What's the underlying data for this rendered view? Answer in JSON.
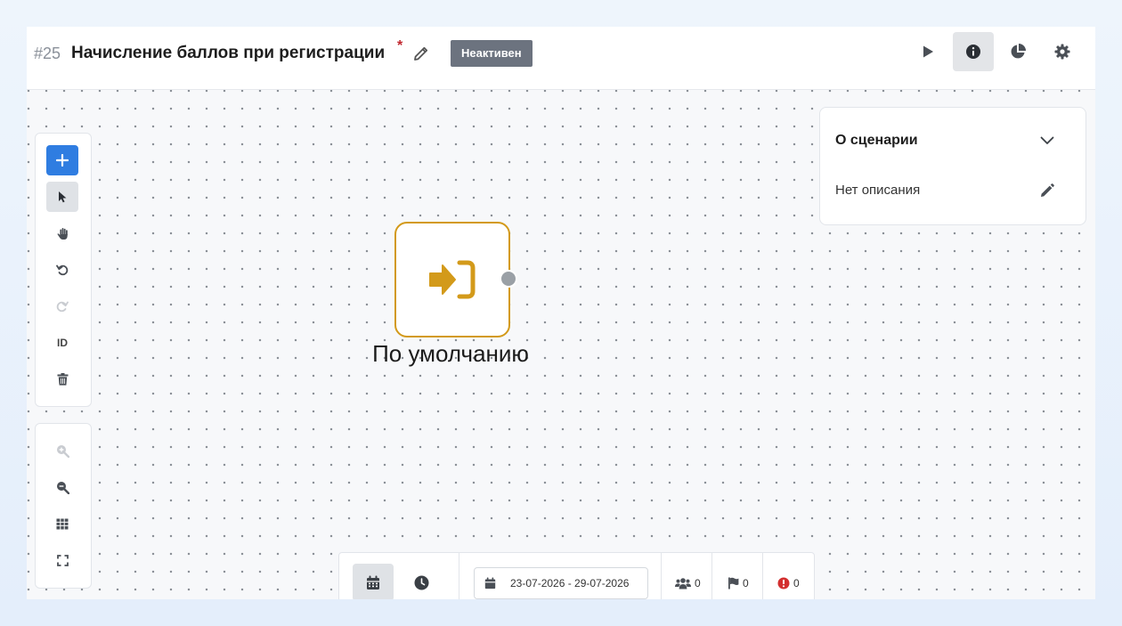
{
  "header": {
    "scenario_id": "#25",
    "title": "Начисление баллов при регистрации",
    "required_mark": "*",
    "status": "Неактивен",
    "actions": [
      {
        "name": "play-icon"
      },
      {
        "name": "info-icon",
        "active": true
      },
      {
        "name": "pie-chart-icon"
      },
      {
        "name": "gear-icon"
      }
    ]
  },
  "toolbar": {
    "add": "plus-icon",
    "select": "cursor-icon",
    "pan": "hand-icon",
    "undo": "undo-icon",
    "redo": "redo-icon",
    "id_label": "ID",
    "delete": "trash-icon"
  },
  "zoom_toolbar": {
    "zoom_in": "zoom-in-icon",
    "zoom_out": "zoom-out-icon",
    "grid": "grid-icon",
    "fit": "fullscreen-icon"
  },
  "node": {
    "label": "По умолчанию",
    "icon": "sign-in-icon",
    "accent": "#d39a1a"
  },
  "about_panel": {
    "title": "О сценарии",
    "description": "Нет описания"
  },
  "bottom_bar": {
    "date_range": "23-07-2026 - 29-07-2026",
    "users_count": "0",
    "goals_count": "0",
    "errors_count": "0"
  },
  "colors": {
    "primary": "#2f7de1",
    "badge": "#6c737f",
    "error": "#d32f2f",
    "required": "#c0262d"
  }
}
